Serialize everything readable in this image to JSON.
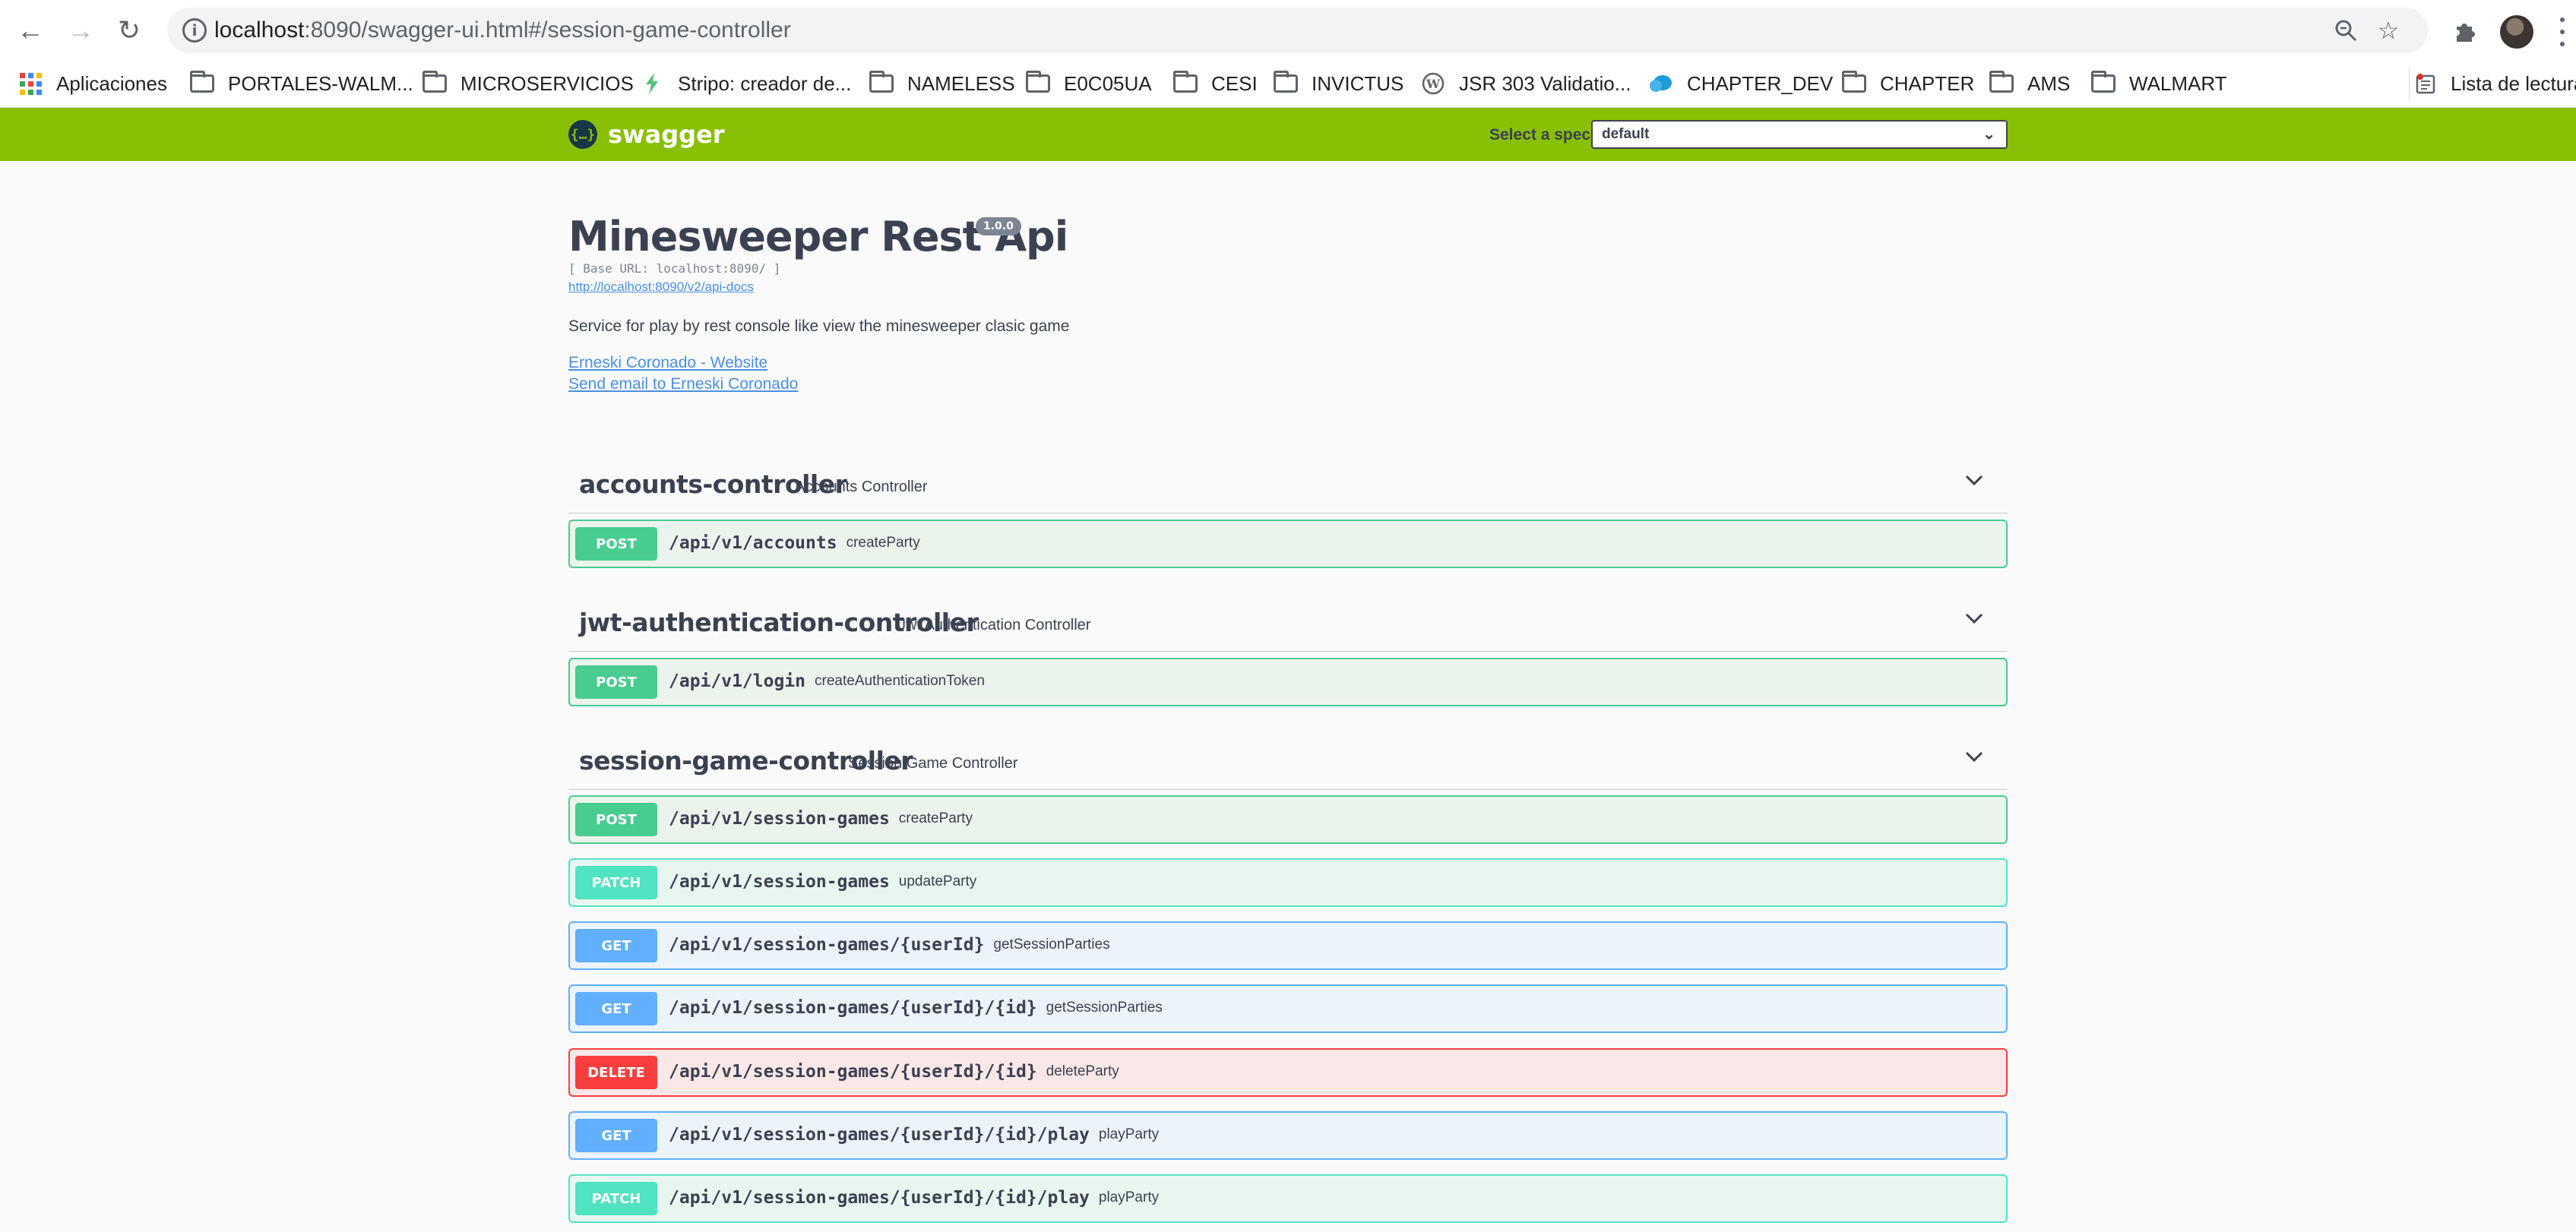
{
  "browser": {
    "url_host": "localhost",
    "url_rest": ":8090/swagger-ui.html#/session-game-controller",
    "bookmarks": [
      {
        "label": "Aplicaciones",
        "icon": "apps-grid-icon"
      },
      {
        "label": "PORTALES-WALM...",
        "icon": "folder-icon"
      },
      {
        "label": "MICROSERVICIOS",
        "icon": "folder-icon"
      },
      {
        "label": "Stripo: creador de...",
        "icon": "stripo-icon"
      },
      {
        "label": "NAMELESS",
        "icon": "folder-icon"
      },
      {
        "label": "E0C05UA",
        "icon": "folder-icon"
      },
      {
        "label": "CESI",
        "icon": "folder-icon"
      },
      {
        "label": "INVICTUS",
        "icon": "folder-icon"
      },
      {
        "label": "JSR 303 Validatio...",
        "icon": "wordpress-icon"
      },
      {
        "label": "CHAPTER_DEV",
        "icon": "cloud-icon"
      },
      {
        "label": "CHAPTER",
        "icon": "folder-icon"
      },
      {
        "label": "AMS",
        "icon": "folder-icon"
      },
      {
        "label": "WALMART",
        "icon": "folder-icon"
      },
      {
        "label": "Lista de lectura",
        "icon": "reading-list-icon"
      }
    ]
  },
  "swagger": {
    "logo_text": "swagger",
    "spec_label": "Select a spec",
    "spec_value": "default",
    "brand_color": "#89bf04"
  },
  "info": {
    "title": "Minesweeper Rest Api",
    "version": "1.0.0",
    "base_url": "[ Base URL: localhost:8090/ ]",
    "docs_link": "http://localhost:8090/v2/api-docs",
    "description": "Service for play by rest console like view the minesweeper clasic game",
    "contact_website": "Erneski Coronado - Website",
    "contact_email": "Send email to Erneski Coronado"
  },
  "tags": [
    {
      "name": "accounts-controller",
      "description": "Accounts Controller",
      "operations": [
        {
          "method": "POST",
          "path": "/api/v1/accounts",
          "summary": "createParty"
        }
      ]
    },
    {
      "name": "jwt-authentication-controller",
      "description": "Jwt Authentication Controller",
      "operations": [
        {
          "method": "POST",
          "path": "/api/v1/login",
          "summary": "createAuthenticationToken"
        }
      ]
    },
    {
      "name": "session-game-controller",
      "description": "Session Game Controller",
      "operations": [
        {
          "method": "POST",
          "path": "/api/v1/session-games",
          "summary": "createParty"
        },
        {
          "method": "PATCH",
          "path": "/api/v1/session-games",
          "summary": "updateParty"
        },
        {
          "method": "GET",
          "path": "/api/v1/session-games/{userId}",
          "summary": "getSessionParties"
        },
        {
          "method": "GET",
          "path": "/api/v1/session-games/{userId}/{id}",
          "summary": "getSessionParties"
        },
        {
          "method": "DELETE",
          "path": "/api/v1/session-games/{userId}/{id}",
          "summary": "deleteParty"
        },
        {
          "method": "GET",
          "path": "/api/v1/session-games/{userId}/{id}/play",
          "summary": "playParty"
        },
        {
          "method": "PATCH",
          "path": "/api/v1/session-games/{userId}/{id}/play",
          "summary": "playParty"
        }
      ]
    }
  ],
  "method_colors": {
    "POST": "#49cc90",
    "PATCH": "#50e3c2",
    "GET": "#61affe",
    "DELETE": "#f93e3e"
  }
}
